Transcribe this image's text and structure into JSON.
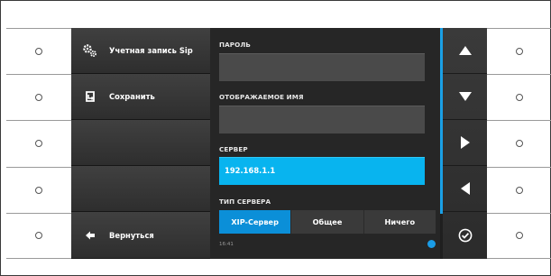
{
  "menu": {
    "items": [
      {
        "label": "Учетная запись Sip",
        "icon": "gears-icon"
      },
      {
        "label": "Сохранить",
        "icon": "save-icon"
      },
      {
        "label": ""
      },
      {
        "label": ""
      },
      {
        "label": "Вернуться",
        "icon": "back-arrow-icon"
      }
    ]
  },
  "form": {
    "password_label": "ПАРОЛЬ",
    "password_value": "",
    "display_name_label": "ОТОБРАЖАЕМОЕ ИМЯ",
    "display_name_value": "",
    "server_label": "СЕРВЕР",
    "server_value": "192.168.1.1",
    "server_type_label": "ТИП СЕРВЕРА",
    "server_type_options": [
      "XIP-Сервер",
      "Общее",
      "Ничего"
    ],
    "server_type_selected": "XIP-Сервер"
  },
  "status": {
    "time": "16:41"
  },
  "nav": {
    "buttons": [
      "up-arrow-icon",
      "down-arrow-icon",
      "right-arrow-icon",
      "left-arrow-icon",
      "confirm-check-icon"
    ]
  },
  "colors": {
    "accent": "#08b4ef",
    "selected_segment": "#0b8fd8",
    "scrollbar": "#1aa0e6"
  }
}
